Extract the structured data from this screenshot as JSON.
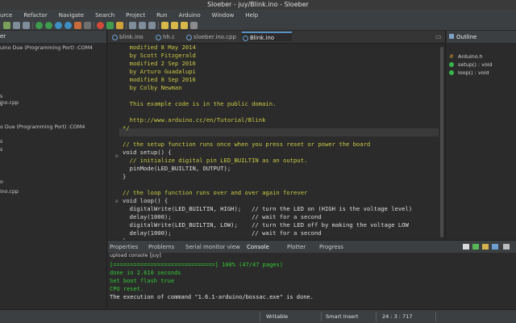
{
  "window": {
    "title": "Sloeber - juy/Blink.ino - Sloeber"
  },
  "menu": [
    "urce",
    "Refactor",
    "Navigate",
    "Search",
    "Project",
    "Run",
    "Arduino",
    "Window",
    "Help"
  ],
  "left_panel": {
    "tab_label": "er",
    "rows": [
      "uino Due (Programming Port) :COM4",
      "s",
      "s",
      "ino.cpp",
      "o Due (Programming Port) :COM4",
      "s",
      "s",
      "o",
      "ino.cpp"
    ]
  },
  "editor": {
    "tabs": [
      "blink.ino",
      "hh.c",
      "sloeber.ino.cpp",
      "Blink.ino"
    ],
    "active_tab": "Blink.ino",
    "lines": [
      {
        "text": "  modified 8 May 2014",
        "cls": "c-com"
      },
      {
        "text": "  by Scott Fitzgerald",
        "cls": "c-com"
      },
      {
        "text": "  modified 2 Sep 2016",
        "cls": "c-com"
      },
      {
        "text": "  by Arturo Guadalupi",
        "cls": "c-com"
      },
      {
        "text": "  modified 8 Sep 2016",
        "cls": "c-com"
      },
      {
        "text": "  by Colby Newman",
        "cls": "c-com"
      },
      {
        "text": "",
        "cls": "c-com"
      },
      {
        "text": "  This example code is in the public domain.",
        "cls": "c-com"
      },
      {
        "text": "",
        "cls": "c-com"
      },
      {
        "text": "  http://www.arduino.cc/en/Tutorial/Blink",
        "cls": "c-com"
      },
      {
        "text": "*/",
        "cls": "c-com"
      },
      {
        "text": "",
        "cls": "c-norm"
      },
      {
        "text": "// the setup function runs once when you press reset or power the board",
        "cls": "c-com"
      },
      {
        "text": "void setup() {",
        "cls": "c-norm"
      },
      {
        "text": "  // initialize digital pin LED_BUILTIN as an output.",
        "cls": "c-com"
      },
      {
        "text": "  pinMode(LED_BUILTIN, OUTPUT);",
        "cls": "c-norm"
      },
      {
        "text": "}",
        "cls": "c-norm"
      },
      {
        "text": "",
        "cls": "c-norm"
      },
      {
        "text": "// the loop function runs over and over again forever",
        "cls": "c-com"
      },
      {
        "text": "void loop() {",
        "cls": "c-norm"
      },
      {
        "text": "  digitalWrite(LED_BUILTIN, HIGH);   // turn the LED on (HIGH is the voltage level)",
        "cls": "c-norm"
      },
      {
        "text": "  delay(1000);                       // wait for a second",
        "cls": "c-norm"
      },
      {
        "text": "  digitalWrite(LED_BUILTIN, LOW);    // turn the LED off by making the voltage LOW",
        "cls": "c-norm"
      },
      {
        "text": "  delay(1000);                       // wait for a second",
        "cls": "c-norm"
      },
      {
        "text": "}",
        "cls": "c-norm"
      }
    ]
  },
  "outline": {
    "label": "Outline",
    "items": [
      "Arduino.h",
      "setup() : void",
      "loop() : void"
    ]
  },
  "bottom": {
    "tabs": [
      "Properties",
      "Problems",
      "Serial monitor view",
      "Console",
      "Plotter",
      "Progress"
    ],
    "active_tab": "Console",
    "subtitle": "upload console [juy]",
    "console_lines": [
      {
        "text": "[==============================] 100% (47/47 pages)",
        "plain": false
      },
      {
        "text": "done in 2.610 seconds",
        "plain": false
      },
      {
        "text": "Set boot flash true",
        "plain": false
      },
      {
        "text": "CPU reset.",
        "plain": false
      },
      {
        "text": "The execution of command \"1.6.1-arduino/bossac.exe\" is done.",
        "plain": true
      }
    ]
  },
  "status": {
    "mode": "Writable",
    "insert": "Smart Insert",
    "position": "24 : 3 : 717"
  },
  "colors": {
    "comment": "#c9c946",
    "console_green": "#35c935",
    "accent_tab": "#5a8fc4"
  }
}
